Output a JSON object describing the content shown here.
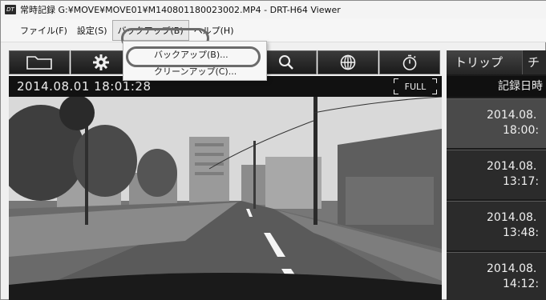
{
  "window": {
    "app_icon": "DT",
    "title": "常時記録 G:¥MOVE¥MOVE01¥M140801180023002.MP4 - DRT-H64 Viewer"
  },
  "menubar": {
    "items": [
      {
        "label": "ファイル(F)"
      },
      {
        "label": "設定(S)"
      },
      {
        "label": "バックアップ(B)"
      },
      {
        "label": "ヘルプ(H)"
      }
    ]
  },
  "dropdown": {
    "items": [
      {
        "label": "バックアップ(B)..."
      },
      {
        "label": "クリーンアップ(C)..."
      }
    ]
  },
  "toolbar": {
    "buttons": [
      {
        "icon": "folder-icon"
      },
      {
        "icon": "gear-icon"
      },
      {
        "icon": "hidden-icon"
      },
      {
        "icon": "hidden-icon"
      },
      {
        "icon": "search-icon"
      },
      {
        "icon": "globe-icon"
      },
      {
        "icon": "stopwatch-icon"
      }
    ]
  },
  "video": {
    "timestamp": "2014.08.01 18:01:28",
    "full_label": "FULL"
  },
  "side_panel": {
    "tabs": [
      {
        "label": "トリップ"
      },
      {
        "label": "チ"
      }
    ],
    "header": "記録日時",
    "records": [
      {
        "date": "2014.08.",
        "time": "18:00:"
      },
      {
        "date": "2014.08.",
        "time": "13:17:"
      },
      {
        "date": "2014.08.",
        "time": "13:48:"
      },
      {
        "date": "2014.08.",
        "time": "14:12:"
      }
    ]
  },
  "colors": {
    "toolbar_bg": "#1a1a1a",
    "panel_bg": "#1b1b1b",
    "highlight_oval": "#6b6b6b"
  }
}
